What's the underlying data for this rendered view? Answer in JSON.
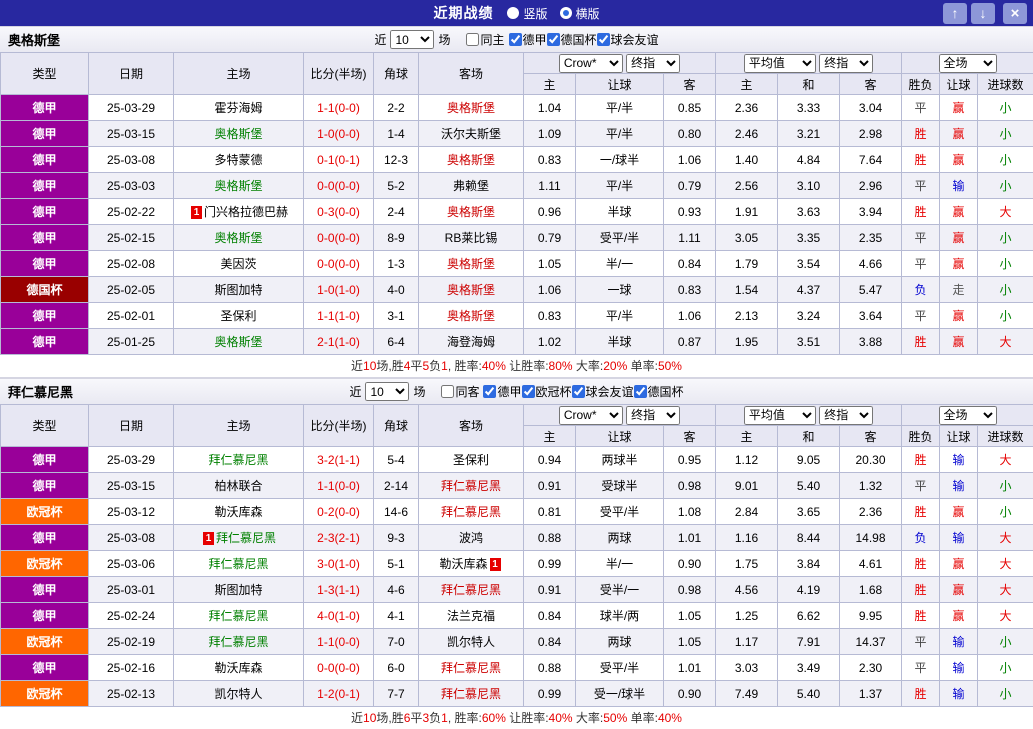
{
  "topbar": {
    "title": "近期战绩",
    "vertical_label": "竖版",
    "horizontal_label": "横版",
    "up_icon": "↑",
    "down_icon": "↓",
    "close_icon": "×"
  },
  "labels": {
    "near": "近",
    "games": "场"
  },
  "cols": {
    "type": "类型",
    "date": "日期",
    "home": "主场",
    "score": "比分(半场)",
    "corner": "角球",
    "away": "客场",
    "h": "主",
    "handicap": "让球",
    "a": "客",
    "avg_h": "主",
    "draw": "和",
    "avg_a": "客",
    "result": "胜负",
    "cover": "让球",
    "goals": "进球数"
  },
  "selects": {
    "source": "Crow*",
    "final": "终指",
    "avg": "平均值",
    "scope": "全场"
  },
  "colors": {
    "league": {
      "德甲": "#990099",
      "德国杯": "#990000",
      "欧冠杯": "#ff6600"
    },
    "result": {
      "胜": "#e60000",
      "平": "#444444",
      "负": "#0000d0"
    },
    "cover": {
      "赢": "#e60000",
      "输": "#0000d0",
      "走": "#555555"
    },
    "goals": {
      "大": "#e60000",
      "小": "#008000"
    },
    "home_focus": "#008000",
    "away_focus": "#cc0000"
  },
  "sections": [
    {
      "team": "奥格斯堡",
      "count": "10",
      "same_label": "同主",
      "leagues": [
        "德甲",
        "德国杯",
        "球会友谊"
      ],
      "rows": [
        {
          "league": "德甲",
          "date": "25-03-29",
          "home": "霍芬海姆",
          "hm": false,
          "hf": false,
          "score": "1-1(0-0)",
          "corners": "2-2",
          "away": "奥格斯堡",
          "am": false,
          "af": true,
          "o1": "1.04",
          "line": "平/半",
          "o2": "0.85",
          "e1": "2.36",
          "e2": "3.33",
          "e3": "3.04",
          "result": "平",
          "cover": "赢",
          "goals": "小"
        },
        {
          "league": "德甲",
          "date": "25-03-15",
          "home": "奥格斯堡",
          "hm": false,
          "hf": true,
          "score": "1-0(0-0)",
          "corners": "1-4",
          "away": "沃尔夫斯堡",
          "am": false,
          "af": false,
          "o1": "1.09",
          "line": "平/半",
          "o2": "0.80",
          "e1": "2.46",
          "e2": "3.21",
          "e3": "2.98",
          "result": "胜",
          "cover": "赢",
          "goals": "小"
        },
        {
          "league": "德甲",
          "date": "25-03-08",
          "home": "多特蒙德",
          "hm": false,
          "hf": false,
          "score": "0-1(0-1)",
          "corners": "12-3",
          "away": "奥格斯堡",
          "am": false,
          "af": true,
          "o1": "0.83",
          "line": "一/球半",
          "o2": "1.06",
          "e1": "1.40",
          "e2": "4.84",
          "e3": "7.64",
          "result": "胜",
          "cover": "赢",
          "goals": "小"
        },
        {
          "league": "德甲",
          "date": "25-03-03",
          "home": "奥格斯堡",
          "hm": false,
          "hf": true,
          "score": "0-0(0-0)",
          "corners": "5-2",
          "away": "弗赖堡",
          "am": false,
          "af": false,
          "o1": "1.11",
          "line": "平/半",
          "o2": "0.79",
          "e1": "2.56",
          "e2": "3.10",
          "e3": "2.96",
          "result": "平",
          "cover": "输",
          "goals": "小"
        },
        {
          "league": "德甲",
          "date": "25-02-22",
          "home": "门兴格拉德巴赫",
          "hm": true,
          "hf": false,
          "score": "0-3(0-0)",
          "corners": "2-4",
          "away": "奥格斯堡",
          "am": false,
          "af": true,
          "o1": "0.96",
          "line": "半球",
          "o2": "0.93",
          "e1": "1.91",
          "e2": "3.63",
          "e3": "3.94",
          "result": "胜",
          "cover": "赢",
          "goals": "大"
        },
        {
          "league": "德甲",
          "date": "25-02-15",
          "home": "奥格斯堡",
          "hm": false,
          "hf": true,
          "score": "0-0(0-0)",
          "corners": "8-9",
          "away": "RB莱比锡",
          "am": false,
          "af": false,
          "o1": "0.79",
          "line": "受平/半",
          "o2": "1.11",
          "e1": "3.05",
          "e2": "3.35",
          "e3": "2.35",
          "result": "平",
          "cover": "赢",
          "goals": "小"
        },
        {
          "league": "德甲",
          "date": "25-02-08",
          "home": "美因茨",
          "hm": false,
          "hf": false,
          "score": "0-0(0-0)",
          "corners": "1-3",
          "away": "奥格斯堡",
          "am": false,
          "af": true,
          "o1": "1.05",
          "line": "半/一",
          "o2": "0.84",
          "e1": "1.79",
          "e2": "3.54",
          "e3": "4.66",
          "result": "平",
          "cover": "赢",
          "goals": "小"
        },
        {
          "league": "德国杯",
          "date": "25-02-05",
          "home": "斯图加特",
          "hm": false,
          "hf": false,
          "score": "1-0(1-0)",
          "corners": "4-0",
          "away": "奥格斯堡",
          "am": false,
          "af": true,
          "o1": "1.06",
          "line": "一球",
          "o2": "0.83",
          "e1": "1.54",
          "e2": "4.37",
          "e3": "5.47",
          "result": "负",
          "cover": "走",
          "goals": "小"
        },
        {
          "league": "德甲",
          "date": "25-02-01",
          "home": "圣保利",
          "hm": false,
          "hf": false,
          "score": "1-1(1-0)",
          "corners": "3-1",
          "away": "奥格斯堡",
          "am": false,
          "af": true,
          "o1": "0.83",
          "line": "平/半",
          "o2": "1.06",
          "e1": "2.13",
          "e2": "3.24",
          "e3": "3.64",
          "result": "平",
          "cover": "赢",
          "goals": "小"
        },
        {
          "league": "德甲",
          "date": "25-01-25",
          "home": "奥格斯堡",
          "hm": false,
          "hf": true,
          "score": "2-1(1-0)",
          "corners": "6-4",
          "away": "海登海姆",
          "am": false,
          "af": false,
          "o1": "1.02",
          "line": "半球",
          "o2": "0.87",
          "e1": "1.95",
          "e2": "3.51",
          "e3": "3.88",
          "result": "胜",
          "cover": "赢",
          "goals": "大"
        }
      ],
      "summary_parts": [
        {
          "t": "近",
          "c": "#333333"
        },
        {
          "t": "10",
          "c": "#e60000"
        },
        {
          "t": "场,胜",
          "c": "#333333"
        },
        {
          "t": "4",
          "c": "#e60000"
        },
        {
          "t": "平",
          "c": "#333333"
        },
        {
          "t": "5",
          "c": "#e60000"
        },
        {
          "t": "负",
          "c": "#333333"
        },
        {
          "t": "1",
          "c": "#e60000"
        },
        {
          "t": ", 胜率:",
          "c": "#333333"
        },
        {
          "t": "40%",
          "c": "#e60000"
        },
        {
          "t": " 让胜率:",
          "c": "#333333"
        },
        {
          "t": "80%",
          "c": "#e60000"
        },
        {
          "t": " 大率:",
          "c": "#333333"
        },
        {
          "t": "20%",
          "c": "#e60000"
        },
        {
          "t": " 单率:",
          "c": "#333333"
        },
        {
          "t": "50%",
          "c": "#e60000"
        }
      ]
    },
    {
      "team": "拜仁慕尼黑",
      "count": "10",
      "same_label": "同客",
      "leagues": [
        "德甲",
        "欧冠杯",
        "球会友谊",
        "德国杯"
      ],
      "rows": [
        {
          "league": "德甲",
          "date": "25-03-29",
          "home": "拜仁慕尼黑",
          "hm": false,
          "hf": true,
          "score": "3-2(1-1)",
          "corners": "5-4",
          "away": "圣保利",
          "am": false,
          "af": false,
          "o1": "0.94",
          "line": "两球半",
          "o2": "0.95",
          "e1": "1.12",
          "e2": "9.05",
          "e3": "20.30",
          "result": "胜",
          "cover": "输",
          "goals": "大"
        },
        {
          "league": "德甲",
          "date": "25-03-15",
          "home": "柏林联合",
          "hm": false,
          "hf": false,
          "score": "1-1(0-0)",
          "corners": "2-14",
          "away": "拜仁慕尼黑",
          "am": false,
          "af": true,
          "o1": "0.91",
          "line": "受球半",
          "o2": "0.98",
          "e1": "9.01",
          "e2": "5.40",
          "e3": "1.32",
          "result": "平",
          "cover": "输",
          "goals": "小"
        },
        {
          "league": "欧冠杯",
          "date": "25-03-12",
          "home": "勒沃库森",
          "hm": false,
          "hf": false,
          "score": "0-2(0-0)",
          "corners": "14-6",
          "away": "拜仁慕尼黑",
          "am": false,
          "af": true,
          "o1": "0.81",
          "line": "受平/半",
          "o2": "1.08",
          "e1": "2.84",
          "e2": "3.65",
          "e3": "2.36",
          "result": "胜",
          "cover": "赢",
          "goals": "小"
        },
        {
          "league": "德甲",
          "date": "25-03-08",
          "home": "拜仁慕尼黑",
          "hm": true,
          "hf": true,
          "score": "2-3(2-1)",
          "corners": "9-3",
          "away": "波鸿",
          "am": false,
          "af": false,
          "o1": "0.88",
          "line": "两球",
          "o2": "1.01",
          "e1": "1.16",
          "e2": "8.44",
          "e3": "14.98",
          "result": "负",
          "cover": "输",
          "goals": "大"
        },
        {
          "league": "欧冠杯",
          "date": "25-03-06",
          "home": "拜仁慕尼黑",
          "hm": false,
          "hf": true,
          "score": "3-0(1-0)",
          "corners": "5-1",
          "away": "勒沃库森",
          "am": true,
          "af": false,
          "o1": "0.99",
          "line": "半/一",
          "o2": "0.90",
          "e1": "1.75",
          "e2": "3.84",
          "e3": "4.61",
          "result": "胜",
          "cover": "赢",
          "goals": "大"
        },
        {
          "league": "德甲",
          "date": "25-03-01",
          "home": "斯图加特",
          "hm": false,
          "hf": false,
          "score": "1-3(1-1)",
          "corners": "4-6",
          "away": "拜仁慕尼黑",
          "am": false,
          "af": true,
          "o1": "0.91",
          "line": "受半/一",
          "o2": "0.98",
          "e1": "4.56",
          "e2": "4.19",
          "e3": "1.68",
          "result": "胜",
          "cover": "赢",
          "goals": "大"
        },
        {
          "league": "德甲",
          "date": "25-02-24",
          "home": "拜仁慕尼黑",
          "hm": false,
          "hf": true,
          "score": "4-0(1-0)",
          "corners": "4-1",
          "away": "法兰克福",
          "am": false,
          "af": false,
          "o1": "0.84",
          "line": "球半/两",
          "o2": "1.05",
          "e1": "1.25",
          "e2": "6.62",
          "e3": "9.95",
          "result": "胜",
          "cover": "赢",
          "goals": "大"
        },
        {
          "league": "欧冠杯",
          "date": "25-02-19",
          "home": "拜仁慕尼黑",
          "hm": false,
          "hf": true,
          "score": "1-1(0-0)",
          "corners": "7-0",
          "away": "凯尔特人",
          "am": false,
          "af": false,
          "o1": "0.84",
          "line": "两球",
          "o2": "1.05",
          "e1": "1.17",
          "e2": "7.91",
          "e3": "14.37",
          "result": "平",
          "cover": "输",
          "goals": "小"
        },
        {
          "league": "德甲",
          "date": "25-02-16",
          "home": "勒沃库森",
          "hm": false,
          "hf": false,
          "score": "0-0(0-0)",
          "corners": "6-0",
          "away": "拜仁慕尼黑",
          "am": false,
          "af": true,
          "o1": "0.88",
          "line": "受平/半",
          "o2": "1.01",
          "e1": "3.03",
          "e2": "3.49",
          "e3": "2.30",
          "result": "平",
          "cover": "输",
          "goals": "小"
        },
        {
          "league": "欧冠杯",
          "date": "25-02-13",
          "home": "凯尔特人",
          "hm": false,
          "hf": false,
          "score": "1-2(0-1)",
          "corners": "7-7",
          "away": "拜仁慕尼黑",
          "am": false,
          "af": true,
          "o1": "0.99",
          "line": "受一/球半",
          "o2": "0.90",
          "e1": "7.49",
          "e2": "5.40",
          "e3": "1.37",
          "result": "胜",
          "cover": "输",
          "goals": "小"
        }
      ],
      "summary_parts": [
        {
          "t": "近",
          "c": "#333333"
        },
        {
          "t": "10",
          "c": "#e60000"
        },
        {
          "t": "场,胜",
          "c": "#333333"
        },
        {
          "t": "6",
          "c": "#e60000"
        },
        {
          "t": "平",
          "c": "#333333"
        },
        {
          "t": "3",
          "c": "#e60000"
        },
        {
          "t": "负",
          "c": "#333333"
        },
        {
          "t": "1",
          "c": "#e60000"
        },
        {
          "t": ", 胜率:",
          "c": "#333333"
        },
        {
          "t": "60%",
          "c": "#e60000"
        },
        {
          "t": " 让胜率:",
          "c": "#333333"
        },
        {
          "t": "40%",
          "c": "#e60000"
        },
        {
          "t": " 大率:",
          "c": "#333333"
        },
        {
          "t": "50%",
          "c": "#e60000"
        },
        {
          "t": " 单率:",
          "c": "#333333"
        },
        {
          "t": "40%",
          "c": "#e60000"
        }
      ]
    }
  ]
}
